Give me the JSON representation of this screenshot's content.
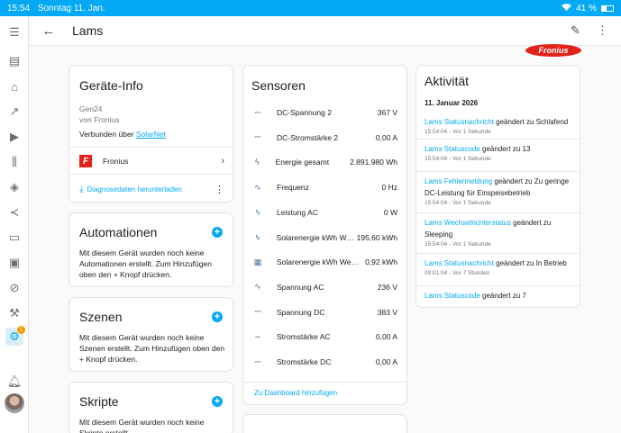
{
  "status_bar": {
    "time": "15:54",
    "date": "Sonntag 11. Jan.",
    "battery": "41 %"
  },
  "topbar": {
    "title": "Lams"
  },
  "logo": {
    "text": "Fronius"
  },
  "device_info": {
    "title": "Geräte-Info",
    "model": "Gen24",
    "manufacturer": "von Fronius",
    "connected_prefix": "Verbunden über",
    "connected_link": "SolarNet",
    "integration": "Fronius",
    "download_label": "Diagnosedaten herunterladen"
  },
  "automations": {
    "title": "Automationen",
    "text": "Mit diesem Gerät wurden noch keine Automationen erstellt. Zum Hinzufügen oben den + Knopf drücken."
  },
  "scenes": {
    "title": "Szenen",
    "text": "Mit diesem Gerät wurden noch keine Szenen erstellt. Zum Hinzufügen oben den + Knopf drücken."
  },
  "scripts": {
    "title": "Skripte",
    "text": "Mit diesem Gerät wurden noch keine Skripte erstellt."
  },
  "sensors": {
    "title": "Sensoren",
    "rows": [
      {
        "icon": "dc-icon",
        "glyph": "⎓",
        "name": "DC-Spannung 2",
        "value": "367 V"
      },
      {
        "icon": "dc-icon",
        "glyph": "⎓",
        "name": "DC-Stromstärke 2",
        "value": "0,00 A"
      },
      {
        "icon": "flash-icon",
        "glyph": "ϟ",
        "name": "Energie gesamt",
        "value": "2.891.980 Wh"
      },
      {
        "icon": "sine-wave-icon",
        "glyph": "∿",
        "name": "Frequenz",
        "value": "0 Hz"
      },
      {
        "icon": "flash-icon",
        "glyph": "ϟ",
        "name": "Leistung AC",
        "value": "0 W"
      },
      {
        "icon": "flash-icon",
        "glyph": "ϟ",
        "name": "Solarenergie kWh Wechselrichter",
        "value": "195,60 kWh"
      },
      {
        "icon": "calendar-icon",
        "glyph": "▦",
        "name": "Solarenergie kWh Wechselrichter",
        "value": "0,92 kWh"
      },
      {
        "icon": "sine-wave-icon",
        "glyph": "∿",
        "name": "Spannung AC",
        "value": "236 V"
      },
      {
        "icon": "dc-icon",
        "glyph": "⎓",
        "name": "Spannung DC",
        "value": "383 V"
      },
      {
        "icon": "ac-icon",
        "glyph": "∼",
        "name": "Stromstärke AC",
        "value": "0,00 A"
      },
      {
        "icon": "dc-icon",
        "glyph": "⎓",
        "name": "Stromstärke DC",
        "value": "0,00 A"
      }
    ],
    "add_to_dashboard": "Zu Dashboard hinzufügen"
  },
  "activity": {
    "title": "Aktivität",
    "date": "11. Januar 2026",
    "items": [
      {
        "entity": "Lams Statusnachricht",
        "text": " geändert zu Schlafend",
        "time": "15:54:04 - Vor 1 Sekunde"
      },
      {
        "entity": "Lams Statuscode",
        "text": " geändert zu 13",
        "time": "15:54:04 - Vor 1 Sekunde"
      },
      {
        "entity": "Lams Fehlermeldung",
        "text": " geändert zu Zu geringe DC-Leistung für Einspeisebetrieb",
        "time": "15:54:04 - Vor 1 Sekunde"
      },
      {
        "entity": "Lams Wechselrichterstatus",
        "text": " geändert zu Sleeping",
        "time": "15:54:04 - Vor 1 Sekunde"
      },
      {
        "entity": "Lams Statusnachricht",
        "text": " geändert zu In Betrieb",
        "time": "09:01:04 - Vor 7 Stunden"
      },
      {
        "entity": "Lams Statuscode",
        "text": " geändert zu 7",
        "time": ""
      }
    ]
  },
  "sidebar": {
    "items": [
      {
        "name": "overview",
        "glyph": "☰"
      },
      {
        "name": "energy",
        "glyph": "▤"
      },
      {
        "name": "history",
        "glyph": "↗"
      },
      {
        "name": "media",
        "glyph": "▶"
      },
      {
        "name": "logbook",
        "glyph": "⫼"
      },
      {
        "name": "docker",
        "glyph": "◈"
      },
      {
        "name": "vscode",
        "glyph": "≺"
      },
      {
        "name": "terminal",
        "glyph": "▭"
      },
      {
        "name": "todo",
        "glyph": "▣"
      },
      {
        "name": "map",
        "glyph": "⊘"
      },
      {
        "name": "developer-tools",
        "glyph": "⚒"
      },
      {
        "name": "settings",
        "glyph": "⚙"
      }
    ],
    "settings_badge": "1"
  }
}
